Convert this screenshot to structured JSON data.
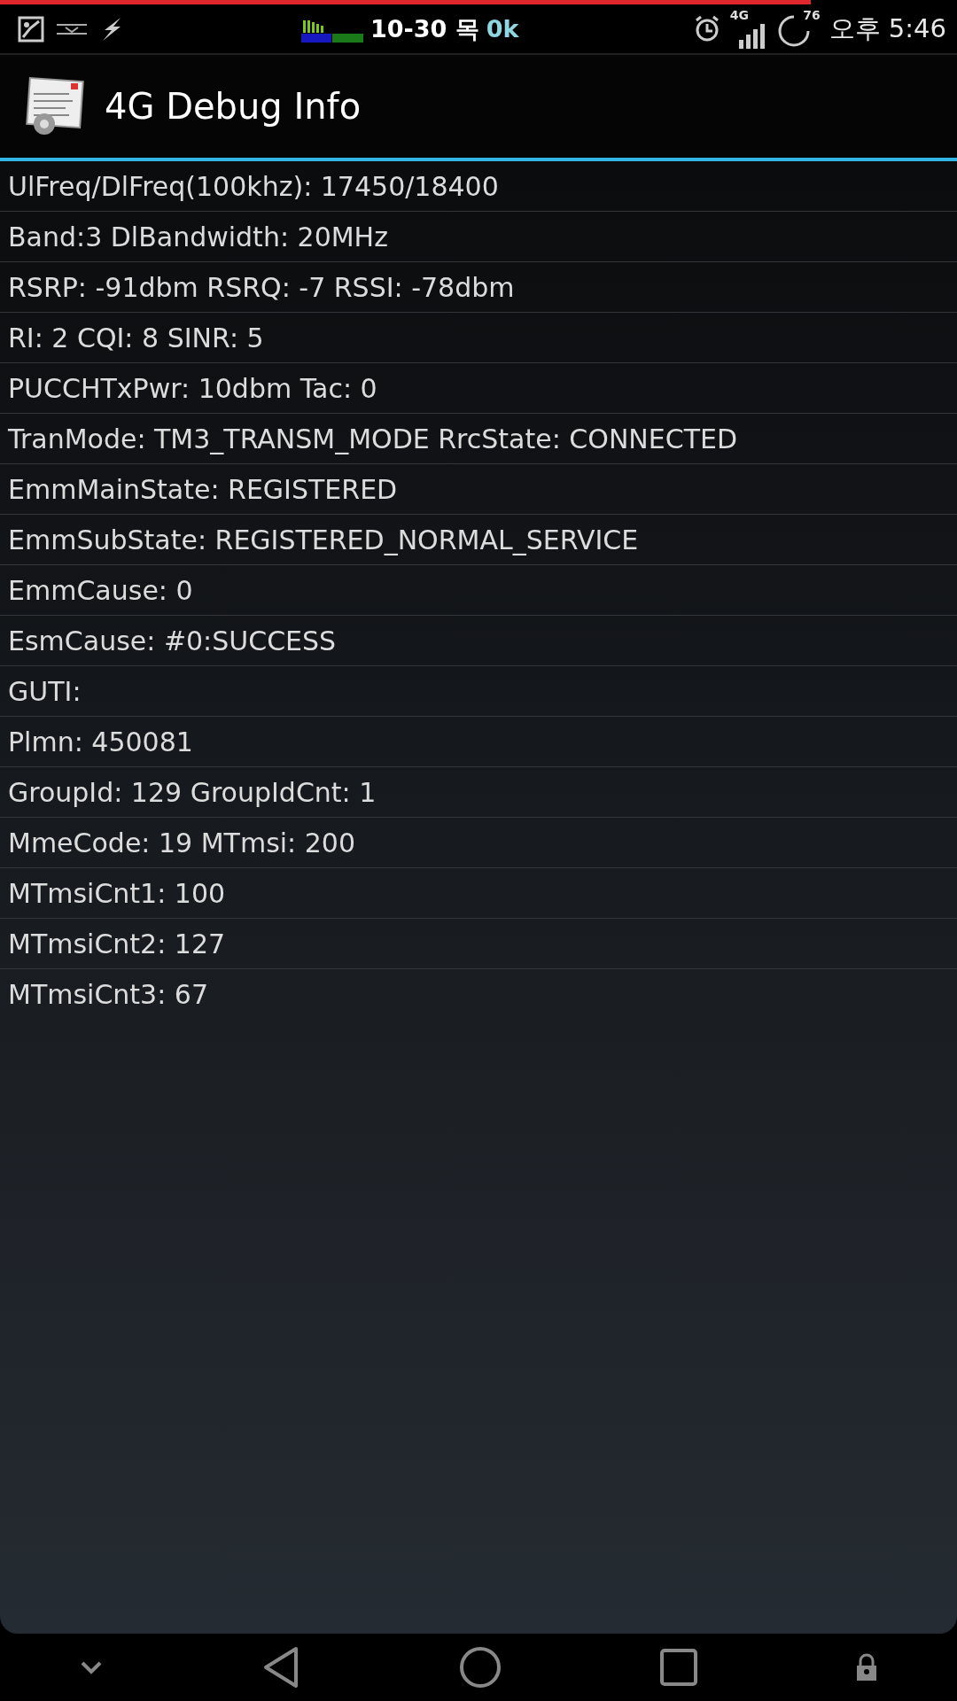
{
  "status_bar": {
    "date": "10-30 목",
    "speed": "0k",
    "network": "4G",
    "battery": "76",
    "time": "오후 5:46"
  },
  "action_bar": {
    "title": "4G Debug Info"
  },
  "rows": [
    "UlFreq/DlFreq(100khz): 17450/18400",
    "Band:3 DlBandwidth: 20MHz",
    "RSRP: -91dbm RSRQ: -7 RSSI: -78dbm",
    "RI: 2 CQI: 8 SINR: 5",
    "PUCCHTxPwr: 10dbm Tac: 0",
    "TranMode: TM3_TRANSM_MODE RrcState: CONNECTED",
    "EmmMainState: REGISTERED",
    "EmmSubState: REGISTERED_NORMAL_SERVICE",
    "EmmCause: 0",
    "EsmCause: #0:SUCCESS",
    "GUTI:",
    "Plmn: 450081",
    "GroupId: 129 GroupIdCnt: 1",
    "MmeCode: 19 MTmsi: 200",
    "MTmsiCnt1: 100",
    "MTmsiCnt2: 127",
    "MTmsiCnt3: 67"
  ]
}
